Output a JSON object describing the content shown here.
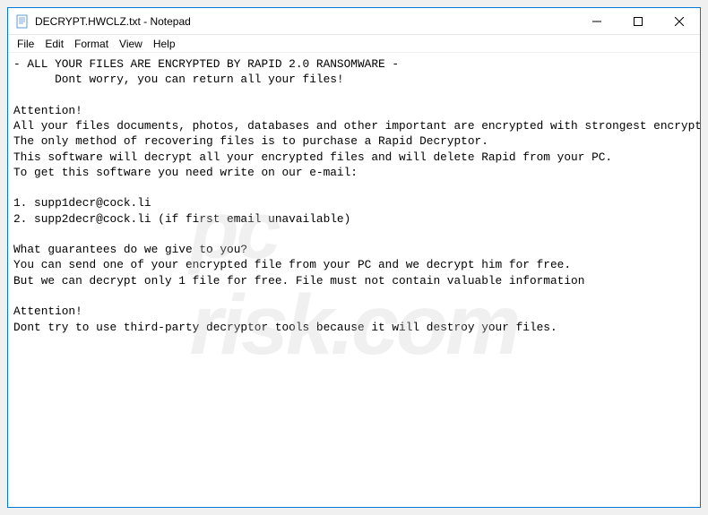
{
  "titlebar": {
    "title": "DECRYPT.HWCLZ.txt - Notepad"
  },
  "menubar": {
    "items": [
      "File",
      "Edit",
      "Format",
      "View",
      "Help"
    ]
  },
  "content": {
    "lines": [
      "- ALL YOUR FILES ARE ENCRYPTED BY RAPID 2.0 RANSOMWARE -",
      "      Dont worry, you can return all your files!",
      "",
      "Attention!",
      "All your files documents, photos, databases and other important are encrypted with strongest encryption",
      "The only method of recovering files is to purchase a Rapid Decryptor.",
      "This software will decrypt all your encrypted files and will delete Rapid from your PC.",
      "To get this software you need write on our e-mail:",
      "",
      "1. supp1decr@cock.li",
      "2. supp2decr@cock.li (if first email unavailable)",
      "",
      "What guarantees do we give to you?",
      "You can send one of your encrypted file from your PC and we decrypt him for free.",
      "But we can decrypt only 1 file for free. File must not contain valuable information",
      "",
      "Attention!",
      "Dont try to use third-party decryptor tools because it will destroy your files."
    ]
  },
  "watermark": {
    "brand": "pc",
    "domain": "risk.com"
  }
}
